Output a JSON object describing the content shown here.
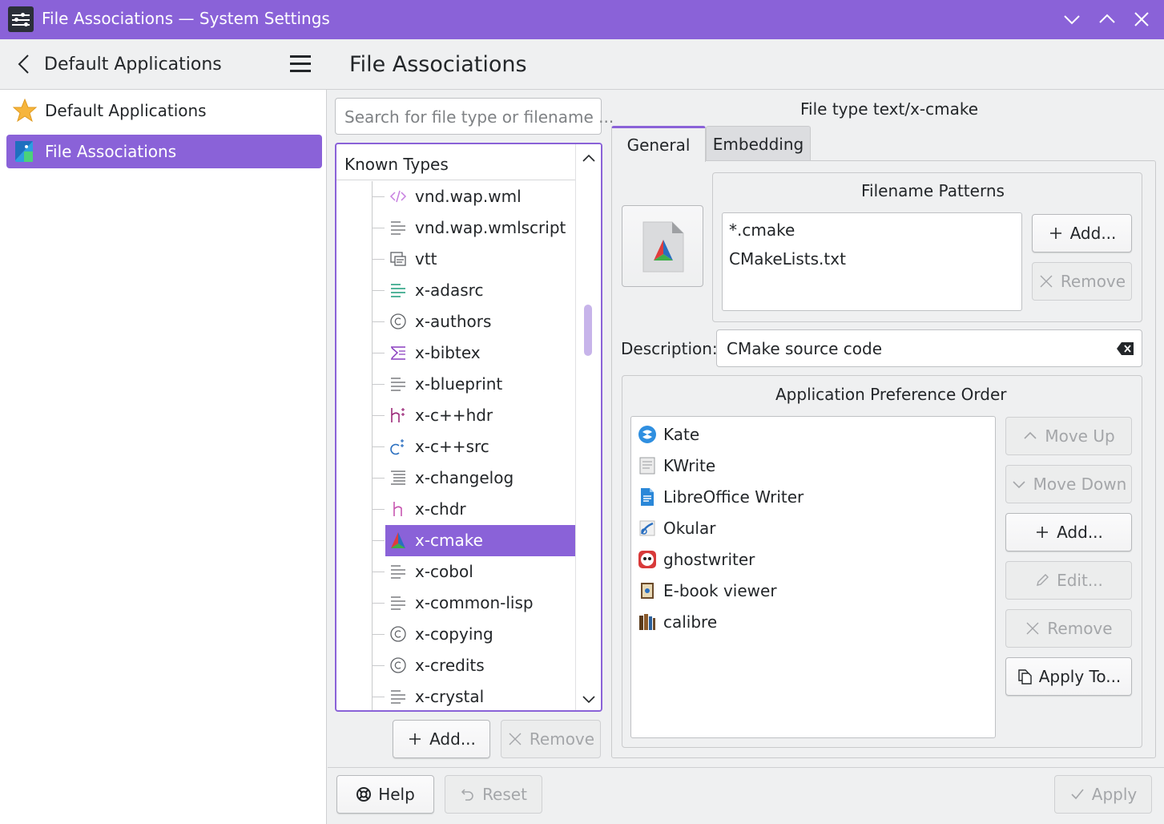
{
  "window": {
    "title": "File Associations — System Settings",
    "accent_color": "#8a62d8"
  },
  "header": {
    "back_title": "Default Applications",
    "page_title": "File Associations"
  },
  "sidebar": {
    "items": [
      {
        "label": "Default Applications",
        "icon": "star-icon",
        "selected": false
      },
      {
        "label": "File Associations",
        "icon": "file-associations-icon",
        "selected": true
      }
    ]
  },
  "search": {
    "placeholder": "Search for file type or filename ..."
  },
  "known_types": {
    "header": "Known Types",
    "items": [
      {
        "label": "vnd.wap.wml",
        "icon": "code-icon"
      },
      {
        "label": "vnd.wap.wmlscript",
        "icon": "text-icon"
      },
      {
        "label": "vtt",
        "icon": "subtitle-icon"
      },
      {
        "label": "x-adasrc",
        "icon": "ada-icon"
      },
      {
        "label": "x-authors",
        "icon": "copyright-icon"
      },
      {
        "label": "x-bibtex",
        "icon": "bibtex-icon"
      },
      {
        "label": "x-blueprint",
        "icon": "text-icon"
      },
      {
        "label": "x-c++hdr",
        "icon": "cpp-header-icon"
      },
      {
        "label": "x-c++src",
        "icon": "cpp-source-icon"
      },
      {
        "label": "x-changelog",
        "icon": "changelog-icon"
      },
      {
        "label": "x-chdr",
        "icon": "c-header-icon"
      },
      {
        "label": "x-cmake",
        "icon": "cmake-icon",
        "selected": true
      },
      {
        "label": "x-cobol",
        "icon": "text-icon"
      },
      {
        "label": "x-common-lisp",
        "icon": "text-icon"
      },
      {
        "label": "x-copying",
        "icon": "copyright-icon"
      },
      {
        "label": "x-credits",
        "icon": "copyright-icon"
      },
      {
        "label": "x-crystal",
        "icon": "text-icon"
      }
    ],
    "add_label": "Add...",
    "remove_label": "Remove"
  },
  "detail": {
    "file_type_title": "File type text/x-cmake",
    "tabs": [
      {
        "label": "General",
        "active": true
      },
      {
        "label": "Embedding",
        "active": false
      }
    ],
    "filename_patterns": {
      "title": "Filename Patterns",
      "items": [
        "*.cmake",
        "CMakeLists.txt"
      ],
      "add_label": "Add...",
      "remove_label": "Remove"
    },
    "description": {
      "label": "Description:",
      "value": "CMake source code"
    },
    "app_preference": {
      "title": "Application Preference Order",
      "apps": [
        {
          "label": "Kate",
          "icon": "kate-icon"
        },
        {
          "label": "KWrite",
          "icon": "kwrite-icon"
        },
        {
          "label": "LibreOffice Writer",
          "icon": "libreoffice-writer-icon"
        },
        {
          "label": "Okular",
          "icon": "okular-icon"
        },
        {
          "label": "ghostwriter",
          "icon": "ghostwriter-icon"
        },
        {
          "label": "E-book viewer",
          "icon": "ebook-viewer-icon"
        },
        {
          "label": "calibre",
          "icon": "calibre-icon"
        }
      ],
      "move_up_label": "Move Up",
      "move_down_label": "Move Down",
      "add_label": "Add...",
      "edit_label": "Edit...",
      "remove_label": "Remove",
      "apply_to_label": "Apply To..."
    }
  },
  "footer": {
    "help_label": "Help",
    "reset_label": "Reset",
    "apply_label": "Apply"
  }
}
